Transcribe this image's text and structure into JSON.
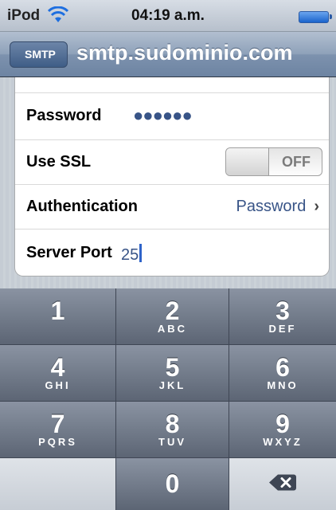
{
  "status": {
    "carrier": "iPod",
    "time": "04:19 a.m."
  },
  "nav": {
    "back_label": "SMTP",
    "title": "smtp.sudominio.com"
  },
  "rows": {
    "password": {
      "label": "Password",
      "value": "●●●●●●"
    },
    "ssl": {
      "label": "Use SSL",
      "toggle": "OFF"
    },
    "auth": {
      "label": "Authentication",
      "value": "Password",
      "chevron": "›"
    },
    "port": {
      "label": "Server Port",
      "value": "25"
    }
  },
  "keypad": {
    "keys": [
      {
        "num": "1",
        "letters": ""
      },
      {
        "num": "2",
        "letters": "ABC"
      },
      {
        "num": "3",
        "letters": "DEF"
      },
      {
        "num": "4",
        "letters": "GHI"
      },
      {
        "num": "5",
        "letters": "JKL"
      },
      {
        "num": "6",
        "letters": "MNO"
      },
      {
        "num": "7",
        "letters": "PQRS"
      },
      {
        "num": "8",
        "letters": "TUV"
      },
      {
        "num": "9",
        "letters": "WXYZ"
      },
      {
        "num": "0",
        "letters": ""
      }
    ],
    "delete_icon": "backspace-icon"
  },
  "colors": {
    "value_blue": "#385487",
    "cursor_blue": "#2e63c9"
  }
}
